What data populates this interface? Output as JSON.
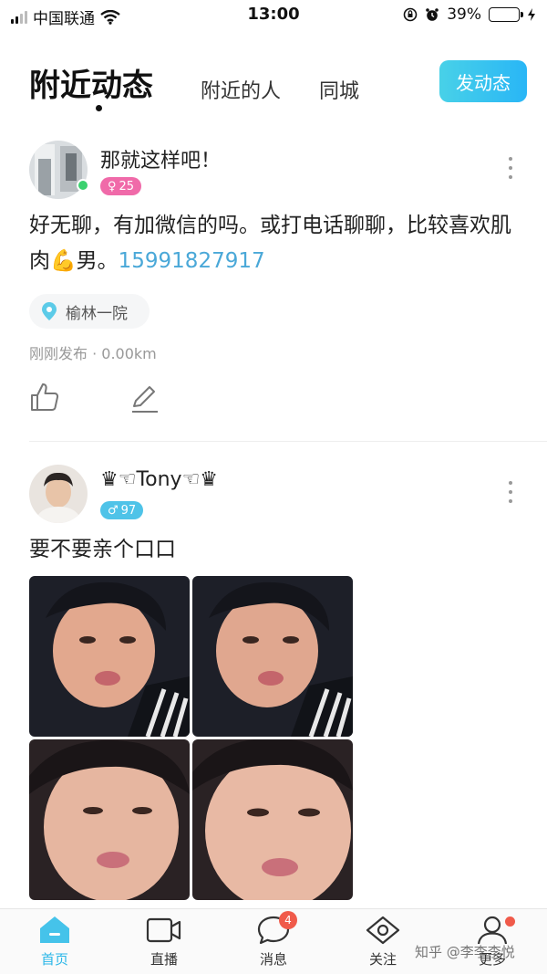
{
  "status_bar": {
    "carrier": "中国联通",
    "time": "13:00",
    "battery_text": "39%",
    "battery_level": 0.39
  },
  "header": {
    "tabs": [
      {
        "label": "附近动态",
        "active": true
      },
      {
        "label": "附近的人",
        "active": false
      },
      {
        "label": "同城",
        "active": false
      }
    ],
    "post_button": "发动态"
  },
  "posts": [
    {
      "username": "那就这样吧！",
      "gender_symbol": "♀",
      "age": "25",
      "badge_color": "#f06aa9",
      "online": true,
      "text": "好无聊，有加微信的吗。或打电话聊聊，比较喜欢肌肉💪男。",
      "phone": "15991827917",
      "location": "榆林一院",
      "meta": "刚刚发布 · 0.00km"
    },
    {
      "username": "♛☜Tony☜♛",
      "gender_symbol": "♂",
      "age": "97",
      "badge_color": "#4fc3e8",
      "online": false,
      "text": "要不要亲个口口",
      "photo_count": 4
    }
  ],
  "tabbar": {
    "items": [
      {
        "label": "首页",
        "icon": "home-icon",
        "active": true
      },
      {
        "label": "直播",
        "icon": "video-camera-icon",
        "active": false
      },
      {
        "label": "消息",
        "icon": "chat-bubble-icon",
        "active": false,
        "badge": "4"
      },
      {
        "label": "关注",
        "icon": "eye-icon",
        "active": false
      },
      {
        "label": "更多",
        "icon": "person-icon",
        "active": false,
        "dot": true
      }
    ]
  },
  "watermark": "知乎 @李李李悦",
  "colors": {
    "accent": "#2ab7e8",
    "phone_link": "#4aa8d8",
    "badge_red": "#f05a4a"
  }
}
